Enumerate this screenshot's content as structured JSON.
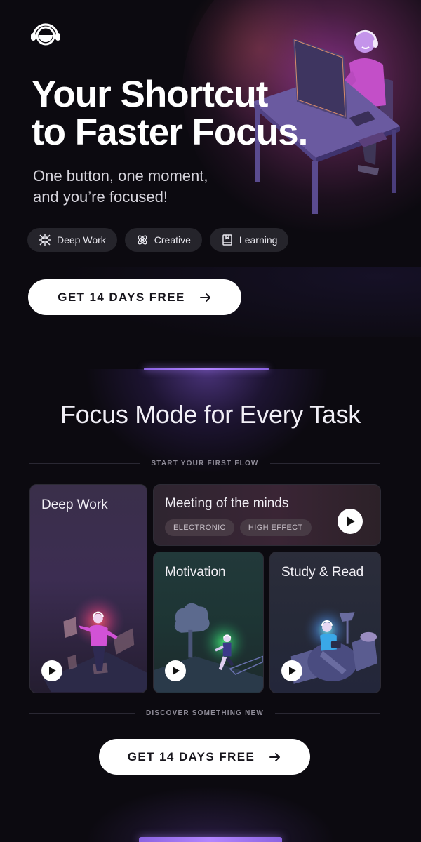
{
  "brand": {
    "logo_icon": "headphones-face-icon"
  },
  "hero": {
    "title_line1": "Your Shortcut",
    "title_line2": "to Faster Focus.",
    "subtitle_line1": "One button, one moment,",
    "subtitle_line2": "and you’re focused!",
    "illustration": "person-at-desk-with-headphones",
    "chips": [
      {
        "label": "Deep Work",
        "icon": "focus-arrows-icon"
      },
      {
        "label": "Creative",
        "icon": "atom-icon"
      },
      {
        "label": "Learning",
        "icon": "book-icon"
      }
    ],
    "cta_label": "GET 14 DAYS FREE",
    "cta_icon": "arrow-right-icon"
  },
  "section": {
    "title": "Focus Mode for Every Task",
    "divider_top": "START YOUR FIRST FLOW",
    "divider_bottom": "DISCOVER SOMETHING NEW",
    "cards": [
      {
        "title": "Deep Work",
        "illustration": "person-with-floating-screens"
      },
      {
        "title": "Meeting of the minds",
        "tags": [
          "ELECTRONIC",
          "HIGH EFFECT"
        ]
      },
      {
        "title": "Motivation",
        "illustration": "person-running-in-park"
      },
      {
        "title": "Study & Read",
        "illustration": "person-reading-on-beanbag"
      }
    ],
    "cta_label": "GET 14 DAYS FREE",
    "cta_icon": "arrow-right-icon"
  },
  "colors": {
    "background": "#0c0a10",
    "accent_purple": "#b385ff",
    "chip_bg": "#25242b",
    "cta_bg": "#ffffff",
    "cta_text": "#17151c"
  }
}
